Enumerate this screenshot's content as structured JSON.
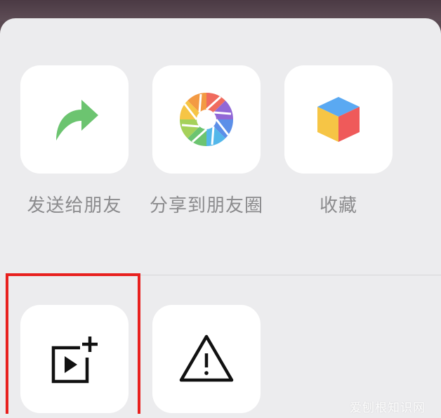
{
  "share_sheet": {
    "actions": [
      {
        "label": "发送给朋友",
        "icon": "share-arrow-icon"
      },
      {
        "label": "分享到朋友圈",
        "icon": "moments-shutter-icon"
      },
      {
        "label": "收藏",
        "icon": "favorites-cube-icon"
      }
    ],
    "more_actions": [
      {
        "icon": "add-to-video-icon"
      },
      {
        "icon": "report-warning-icon"
      }
    ]
  },
  "watermark": "爱刨根知识网",
  "colors": {
    "sheet_background": "#ececee",
    "tile_background": "#ffffff",
    "label_text": "#8b8b8d",
    "share_green": "#6cc470",
    "highlight_red": "#e8201e"
  }
}
